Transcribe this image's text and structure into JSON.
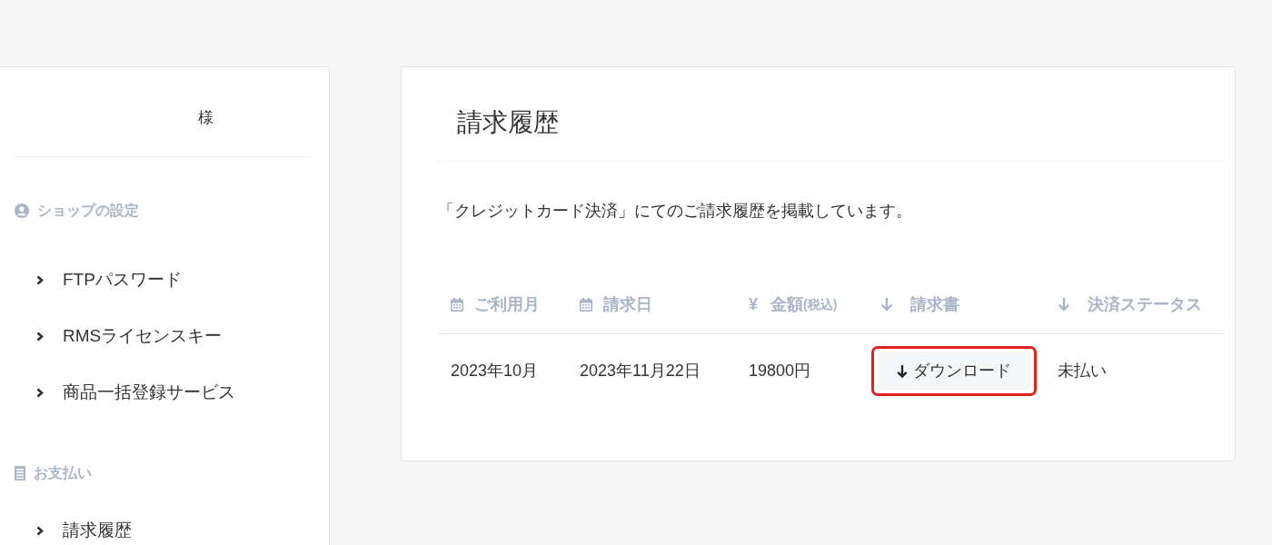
{
  "sidebar": {
    "greeting_suffix": "様",
    "sections": [
      {
        "kind": "shop",
        "title": "ショップの設定",
        "items": [
          {
            "label": "FTPパスワード"
          },
          {
            "label": "RMSライセンスキー"
          },
          {
            "label": "商品一括登録サービス"
          }
        ]
      },
      {
        "kind": "payment",
        "title": "お支払い",
        "items": [
          {
            "label": "請求履歴"
          }
        ]
      }
    ]
  },
  "main": {
    "title": "請求履歴",
    "description": "「クレジットカード決済」にてのご請求履歴を掲載しています。",
    "table": {
      "columns": [
        {
          "kind": "date",
          "label": "ご利用月"
        },
        {
          "kind": "date",
          "label": "請求日"
        },
        {
          "kind": "currency",
          "symbol": "¥",
          "label": "金額",
          "note": "(税込)"
        },
        {
          "kind": "arrow",
          "label": "請求書"
        },
        {
          "kind": "arrow",
          "label": "決済ステータス"
        }
      ],
      "rows": [
        {
          "usage_month": "2023年10月",
          "billing_date": "2023年11月22日",
          "amount": "19800円",
          "invoice": {
            "label": "ダウンロード",
            "highlighted": true
          },
          "status": "未払い"
        }
      ]
    }
  }
}
